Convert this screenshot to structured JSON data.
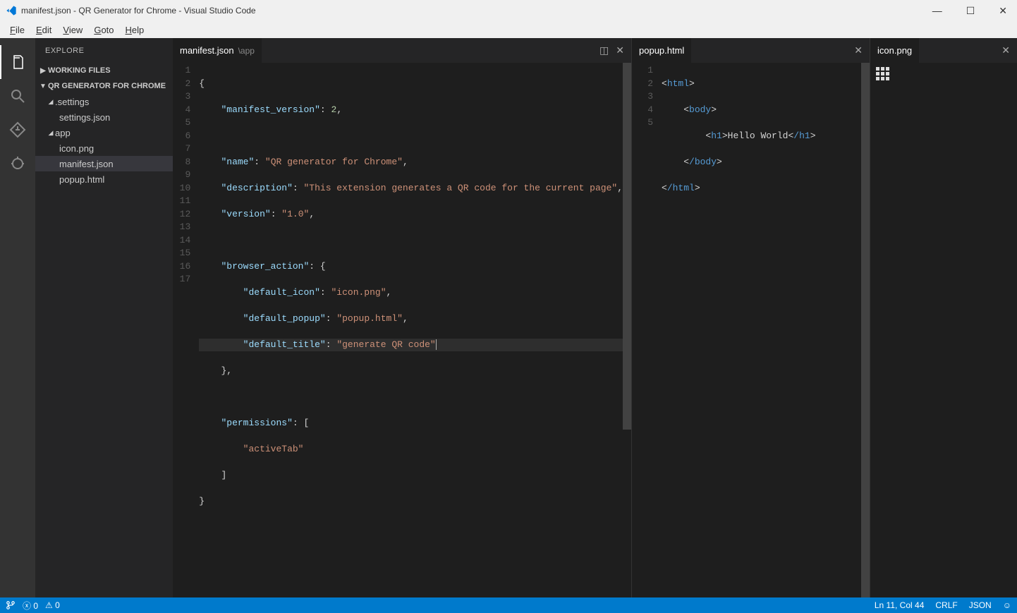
{
  "window": {
    "title": "manifest.json - QR Generator for Chrome - Visual Studio Code"
  },
  "menu": {
    "file": "File",
    "edit": "Edit",
    "view": "View",
    "goto": "Goto",
    "help": "Help"
  },
  "sidebar": {
    "header": "EXPLORE",
    "working_files": "WORKING FILES",
    "project": "QR GENERATOR FOR CHROME",
    "folders": {
      "settings": ".settings",
      "settings_json": "settings.json",
      "app": "app",
      "icon_png": "icon.png",
      "manifest_json": "manifest.json",
      "popup_html": "popup.html"
    }
  },
  "tabs": {
    "manifest": "manifest.json",
    "manifest_path": "\\app",
    "popup": "popup.html",
    "icon": "icon.png"
  },
  "editor1": {
    "lines": [
      "1",
      "2",
      "3",
      "4",
      "5",
      "6",
      "7",
      "8",
      "9",
      "10",
      "11",
      "12",
      "13",
      "14",
      "15",
      "16",
      "17"
    ],
    "content": {
      "manifest_version_key": "\"manifest_version\"",
      "manifest_version_val": "2",
      "name_key": "\"name\"",
      "name_val": "\"QR generator for Chrome\"",
      "description_key": "\"description\"",
      "description_val": "\"This extension generates a QR code for the current page\"",
      "version_key": "\"version\"",
      "version_val": "\"1.0\"",
      "browser_action_key": "\"browser_action\"",
      "default_icon_key": "\"default_icon\"",
      "default_icon_val": "\"icon.png\"",
      "default_popup_key": "\"default_popup\"",
      "default_popup_val": "\"popup.html\"",
      "default_title_key": "\"default_title\"",
      "default_title_val": "\"generate QR code\"",
      "permissions_key": "\"permissions\"",
      "activetab_val": "\"activeTab\""
    }
  },
  "editor2": {
    "lines": [
      "1",
      "2",
      "3",
      "4",
      "5"
    ],
    "content": {
      "html_open": "html",
      "body_open": "body",
      "h1_open": "h1",
      "hello": "Hello World",
      "h1_close": "/h1",
      "body_close": "/body",
      "html_close": "/html"
    }
  },
  "status": {
    "errors": "0",
    "warnings": "0",
    "position": "Ln 11, Col 44",
    "eol": "CRLF",
    "lang": "JSON"
  }
}
